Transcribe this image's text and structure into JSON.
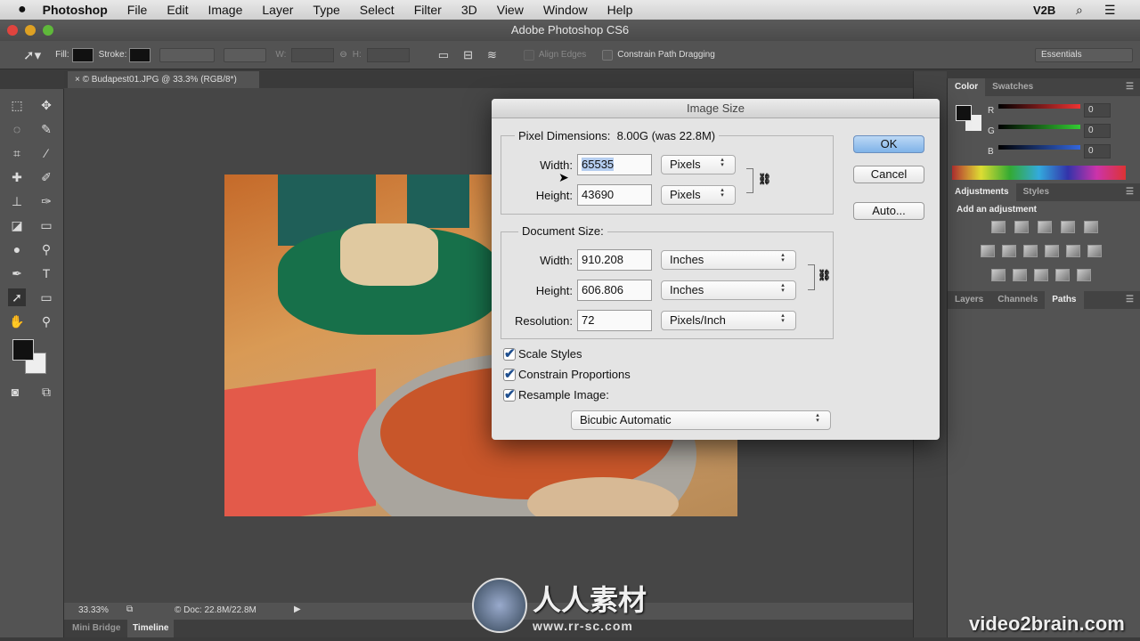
{
  "menubar": {
    "app": "Photoshop",
    "items": [
      "File",
      "Edit",
      "Image",
      "Layer",
      "Type",
      "Select",
      "Filter",
      "3D",
      "View",
      "Window",
      "Help"
    ],
    "user": "V2B"
  },
  "window": {
    "title": "Adobe Photoshop CS6"
  },
  "options": {
    "fill": "Fill:",
    "stroke": "Stroke:",
    "w": "W:",
    "h": "H:",
    "align_edges": "Align Edges",
    "constrain_path": "Constrain Path Dragging",
    "workspace": "Essentials"
  },
  "document": {
    "tab": "© Budapest01.JPG @ 33.3% (RGB/8*)",
    "zoom": "33.33%",
    "doc_info": "© Doc: 22.8M/22.8M"
  },
  "bottom_tabs": [
    "Mini Bridge",
    "Timeline"
  ],
  "color_panel": {
    "tabs": [
      "Color",
      "Swatches"
    ],
    "channels": [
      {
        "label": "R",
        "value": "0"
      },
      {
        "label": "G",
        "value": "0"
      },
      {
        "label": "B",
        "value": "0"
      }
    ]
  },
  "adjustments_panel": {
    "tabs": [
      "Adjustments",
      "Styles"
    ],
    "heading": "Add an adjustment"
  },
  "layers_panel": {
    "tabs": [
      "Layers",
      "Channels",
      "Paths"
    ]
  },
  "dialog": {
    "title": "Image Size",
    "pixel_dimensions": {
      "label": "Pixel Dimensions:",
      "value": "8.00G (was 22.8M)",
      "width_label": "Width:",
      "width": "65535",
      "width_unit": "Pixels",
      "height_label": "Height:",
      "height": "43690",
      "height_unit": "Pixels"
    },
    "document_size": {
      "label": "Document Size:",
      "width_label": "Width:",
      "width": "910.208",
      "width_unit": "Inches",
      "height_label": "Height:",
      "height": "606.806",
      "height_unit": "Inches",
      "resolution_label": "Resolution:",
      "resolution": "72",
      "resolution_unit": "Pixels/Inch"
    },
    "checkboxes": [
      {
        "label": "Scale Styles",
        "checked": true
      },
      {
        "label": "Constrain Proportions",
        "checked": true
      },
      {
        "label": "Resample Image:",
        "checked": true
      }
    ],
    "resample_method": "Bicubic Automatic",
    "buttons": {
      "ok": "OK",
      "cancel": "Cancel",
      "auto": "Auto..."
    }
  },
  "watermarks": {
    "rr": "人人素材",
    "rr_url": "www.rr-sc.com",
    "v2b": "video2brain.com"
  }
}
